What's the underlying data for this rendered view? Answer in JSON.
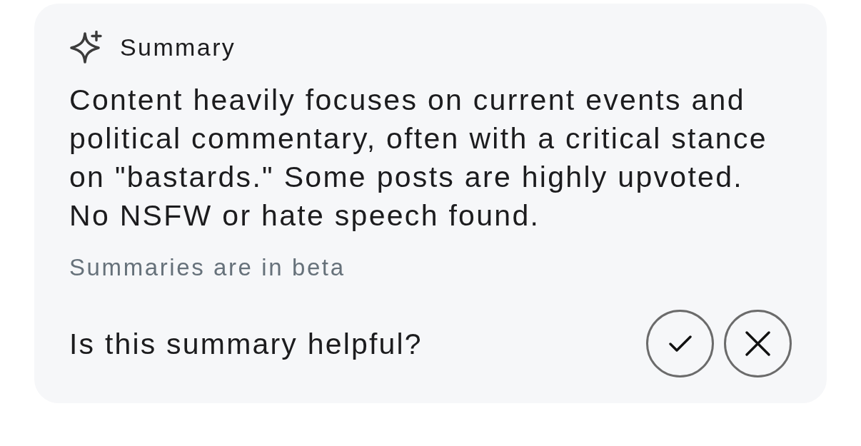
{
  "summary_card": {
    "title": "Summary",
    "text": "Content heavily focuses on current events and political commentary, often with a critical stance on \"bastards.\" Some posts are highly upvoted. No NSFW or hate speech found.",
    "note": "Summaries are in beta",
    "feedback": {
      "question": "Is this summary helpful?",
      "buttons": [
        {
          "kind": "yes"
        },
        {
          "kind": "no"
        }
      ]
    }
  }
}
